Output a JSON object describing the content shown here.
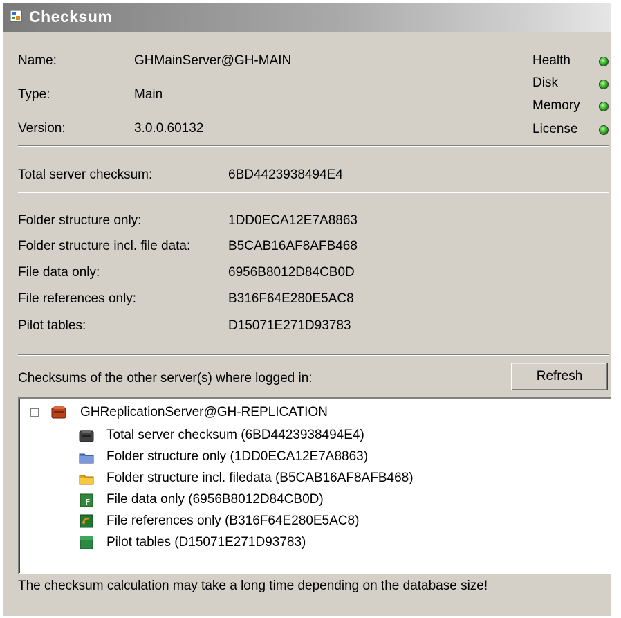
{
  "window": {
    "title": "Checksum",
    "title_icon": "checksum-window-icon"
  },
  "server": {
    "name_label": "Name:",
    "name_value": "GHMainServer@GH-MAIN",
    "type_label": "Type:",
    "type_value": "Main",
    "version_label": "Version:",
    "version_value": "3.0.0.60132"
  },
  "status": [
    {
      "label": "Health",
      "color": "#2fa12a"
    },
    {
      "label": "Disk",
      "color": "#2fa12a"
    },
    {
      "label": "Memory",
      "color": "#2fa12a"
    },
    {
      "label": "License",
      "color": "#2fa12a"
    }
  ],
  "total": {
    "label": "Total server checksum:",
    "value": "6BD4423938494E4"
  },
  "checksums": [
    {
      "label": "Folder structure only:",
      "value": "1DD0ECA12E7A8863"
    },
    {
      "label": "Folder structure incl. file data:",
      "value": "B5CAB16AF8AFB468"
    },
    {
      "label": "File data only:",
      "value": "6956B8012D84CB0D"
    },
    {
      "label": "File references only:",
      "value": "B316F64E280E5AC8"
    },
    {
      "label": "Pilot tables:",
      "value": "D15071E271D93783"
    }
  ],
  "others": {
    "label": "Checksums of the other server(s) where logged in:",
    "refresh_label": "Refresh"
  },
  "tree": {
    "root": {
      "label": "GHReplicationServer@GH-REPLICATION",
      "icon": "server-icon",
      "expander": "collapse-icon"
    },
    "children": [
      {
        "label": "Total server checksum (6BD4423938494E4)",
        "icon": "server-checksum-icon"
      },
      {
        "label": "Folder structure only (1DD0ECA12E7A8863)",
        "icon": "folder-structure-icon"
      },
      {
        "label": "Folder structure incl. filedata (B5CAB16AF8AFB468)",
        "icon": "folder-filedata-icon"
      },
      {
        "label": "File data only (6956B8012D84CB0D)",
        "icon": "file-data-icon"
      },
      {
        "label": "File references only (B316F64E280E5AC8)",
        "icon": "file-references-icon"
      },
      {
        "label": "Pilot tables (D15071E271D93783)",
        "icon": "pilot-tables-icon"
      }
    ]
  },
  "footer": "The checksum calculation may take a long time depending on the database size!"
}
